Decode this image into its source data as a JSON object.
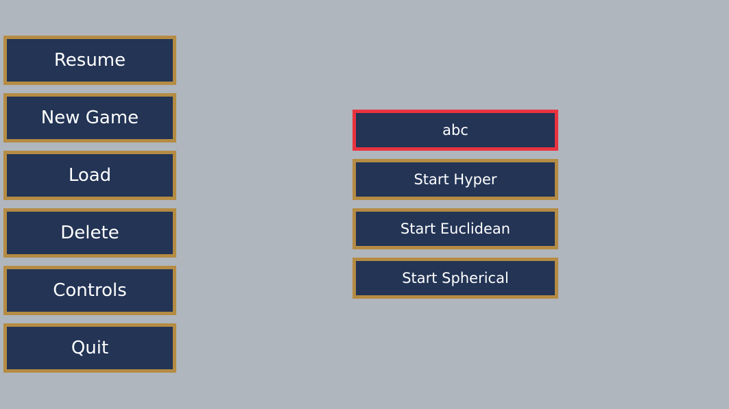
{
  "colors": {
    "background": "#b0b6be",
    "button_fill": "#233455",
    "button_border": "#b58c44",
    "selected_border": "#ea3340",
    "text": "#ffffff"
  },
  "main_menu": {
    "resume": "Resume",
    "new_game": "New Game",
    "load": "Load",
    "delete": "Delete",
    "controls": "Controls",
    "quit": "Quit"
  },
  "side_panel": {
    "save_name": "abc",
    "start_hyper": "Start Hyper",
    "start_euclidean": "Start Euclidean",
    "start_spherical": "Start Spherical"
  }
}
